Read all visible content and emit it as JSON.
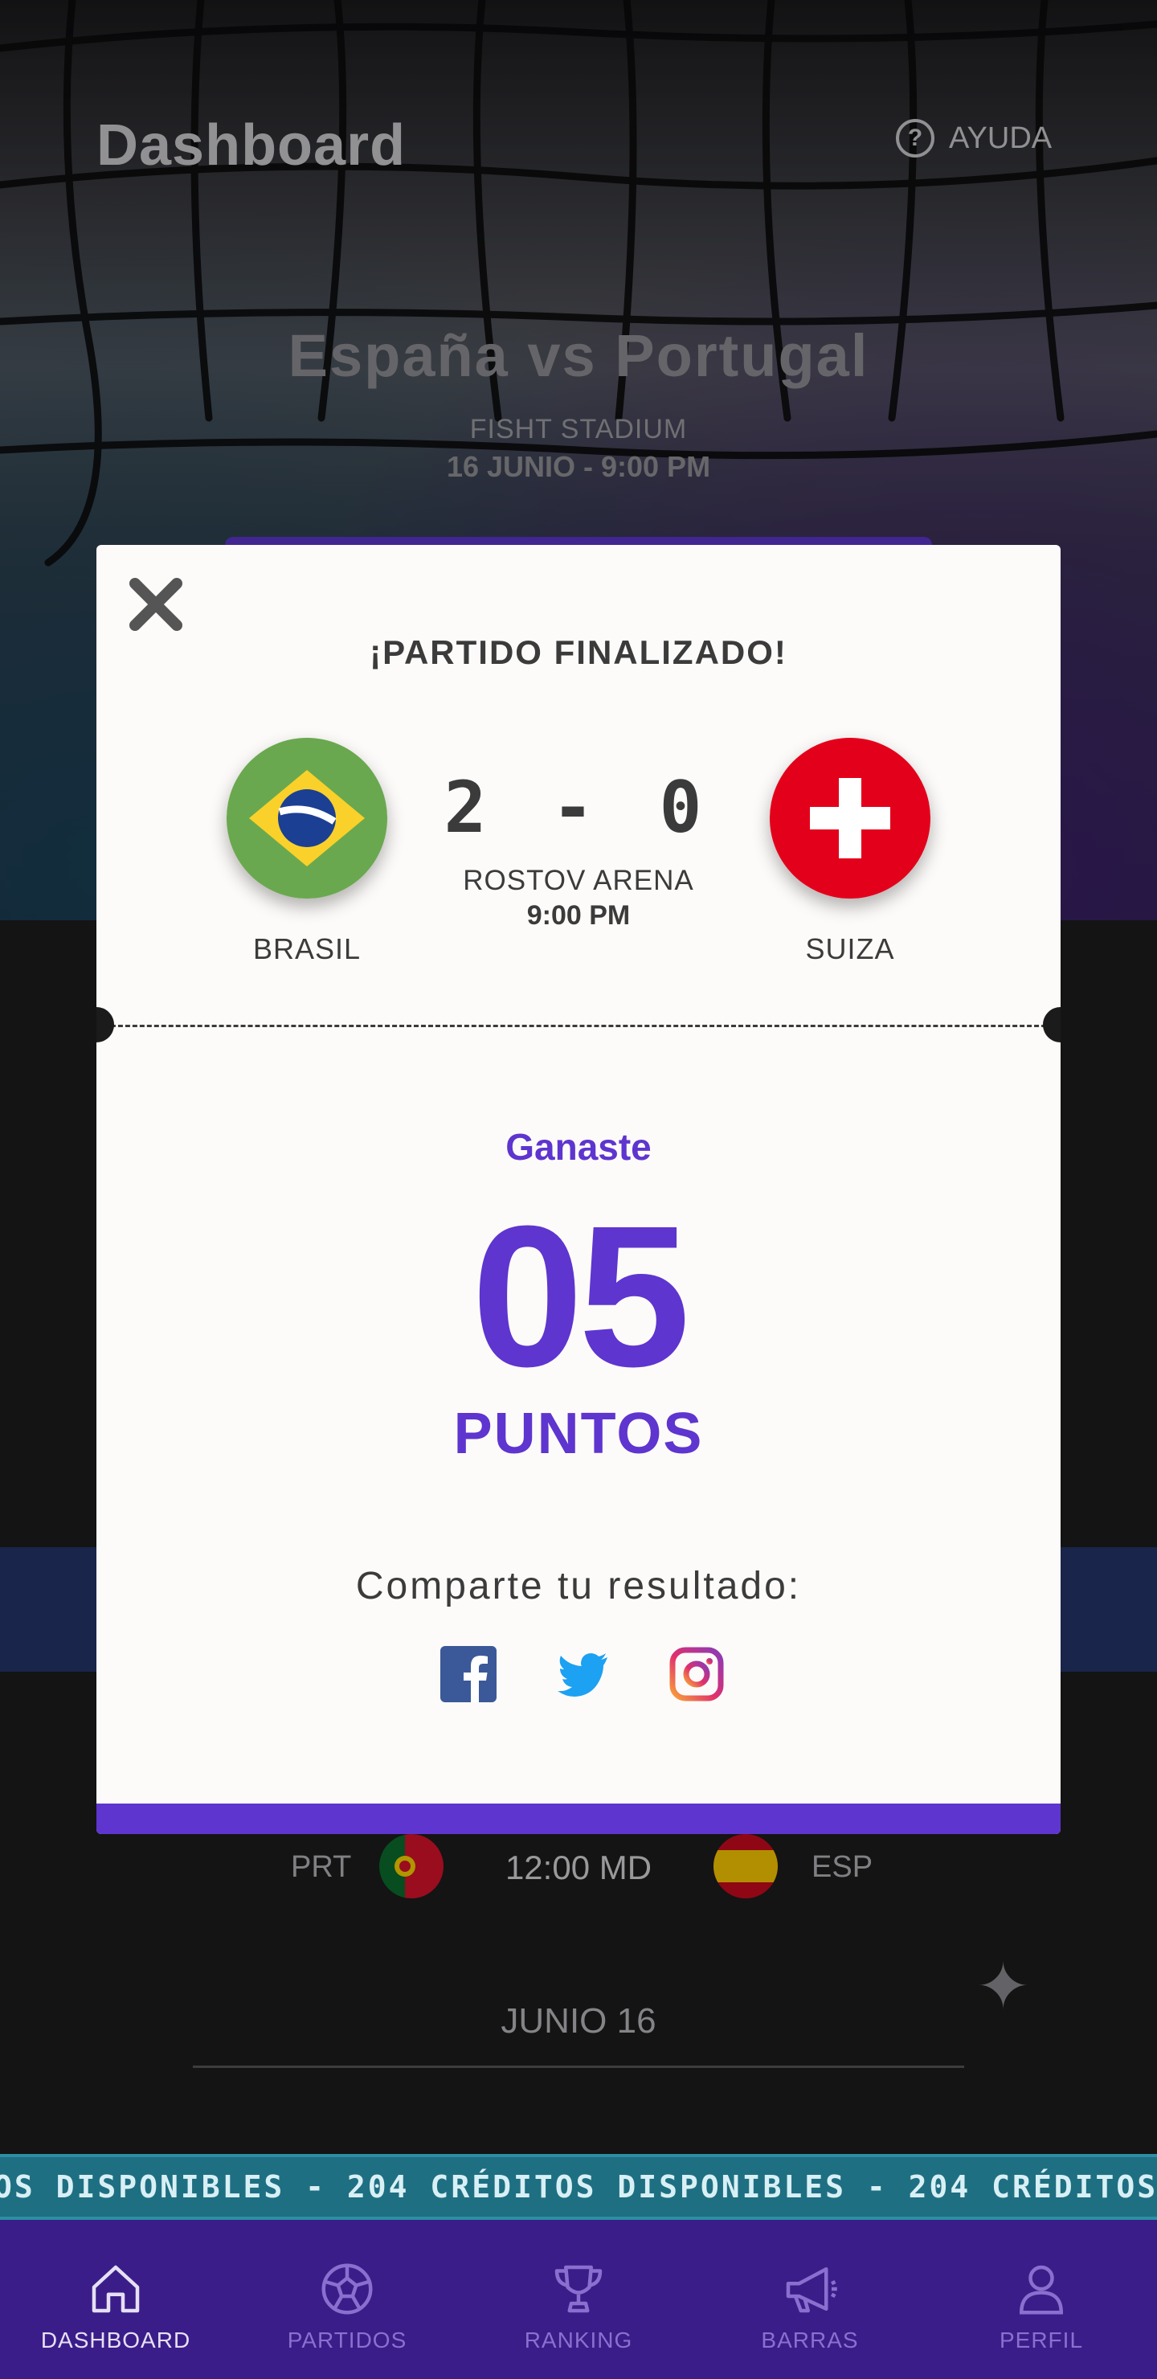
{
  "header": {
    "title": "Dashboard",
    "help_label": "AYUDA",
    "help_glyph": "?"
  },
  "featured_match": {
    "title": "España vs Portugal",
    "stadium": "FISHT STADIUM",
    "datetime": "16 JUNIO - 9:00 PM"
  },
  "schedule": {
    "game": {
      "home_code": "PRT",
      "time": "12:00 MD",
      "away_code": "ESP"
    },
    "date_label": "JUNIO 16"
  },
  "ticker": {
    "text": "OS DISPONIBLES - 204 CRÉDITOS DISPONIBLES - 204 CRÉDITOS"
  },
  "nav": {
    "items": [
      {
        "label": "DASHBOARD",
        "icon": "home-icon",
        "active": true
      },
      {
        "label": "PARTIDOS",
        "icon": "soccer-ball-icon",
        "active": false
      },
      {
        "label": "RANKING",
        "icon": "trophy-icon",
        "active": false
      },
      {
        "label": "BARRAS",
        "icon": "megaphone-icon",
        "active": false
      },
      {
        "label": "PERFIL",
        "icon": "user-icon",
        "active": false
      }
    ]
  },
  "modal": {
    "heading": "¡PARTIDO FINALIZADO!",
    "home_team": "BRASIL",
    "away_team": "SUIZA",
    "score": "2 - 0",
    "venue": "ROSTOV ARENA",
    "time": "9:00 PM",
    "result_label": "Ganaste",
    "points": "05",
    "points_label": "PUNTOS",
    "share_label": "Comparte tu resultado:",
    "social": [
      "facebook-icon",
      "twitter-icon",
      "instagram-icon"
    ]
  },
  "colors": {
    "accent": "#5e35cf",
    "nav_background": "#3b1d89",
    "ticker_background": "#1f6f82",
    "facebook": "#3b5998",
    "twitter": "#1da1f2"
  }
}
